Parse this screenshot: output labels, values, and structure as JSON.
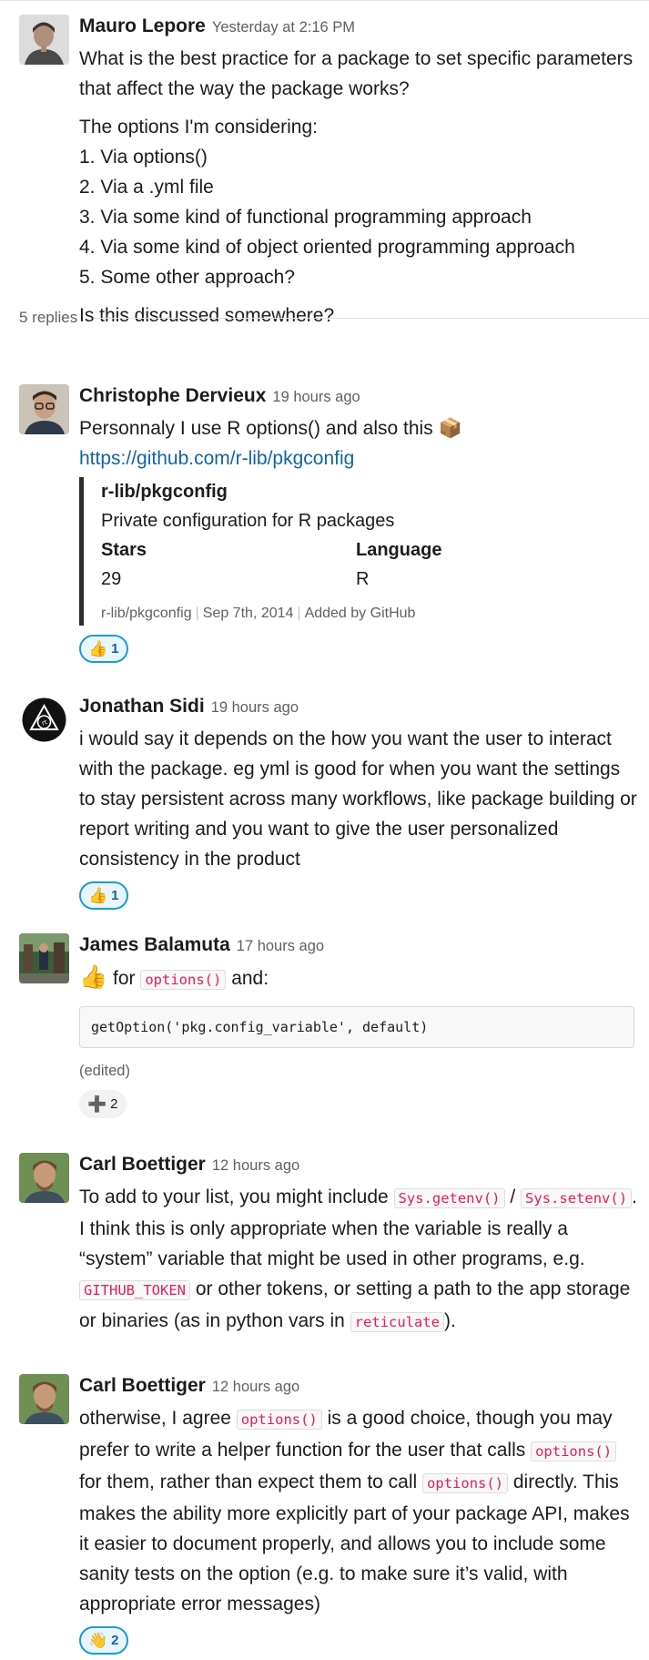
{
  "thread": {
    "replies_label": "5 replies"
  },
  "messages": [
    {
      "author": "Mauro Lepore",
      "time": "Yesterday at 2:16 PM",
      "p1": "What is the best practice for a package to set specific parameters that affect the way the package works?",
      "p2_intro": "The options I'm considering:",
      "options": [
        "1. Via options()",
        "2. Via a .yml file",
        "3. Via some kind of functional programming approach",
        "4. Via some kind of object oriented programming approach",
        "5. Some other approach?"
      ],
      "p3": "Is this discussed somewhere?"
    },
    {
      "author": "Christophe Dervieux",
      "time": "19 hours ago",
      "text": "Personnaly I use R options() and also this",
      "emoji": "📦",
      "link": "https://github.com/r-lib/pkgconfig",
      "attachment": {
        "title": "r-lib/pkgconfig",
        "description": "Private configuration for R packages",
        "fields": [
          {
            "title": "Stars",
            "value": "29"
          },
          {
            "title": "Language",
            "value": "R"
          }
        ],
        "footer": [
          "r-lib/pkgconfig",
          "Sep 7th, 2014",
          "Added by GitHub"
        ]
      },
      "reaction": {
        "emoji": "👍",
        "count": "1"
      }
    },
    {
      "author": "Jonathan Sidi",
      "time": "19 hours ago",
      "text": "i would say it depends on the how you want the user to interact with the package. eg yml is good for when you want the settings to stay persistent across many workflows, like package building or report writing and you want to give the user personalized consistency in the product",
      "reaction": {
        "emoji": "👍",
        "count": "1"
      }
    },
    {
      "author": "James Balamuta",
      "time": "17 hours ago",
      "emoji": "👍",
      "text_a": "for",
      "code": "options()",
      "text_b": "and:",
      "codeblock": "getOption('pkg.config_variable', default)",
      "edited": "(edited)",
      "reaction": {
        "emoji": "➕",
        "count": "2"
      }
    },
    {
      "author": "Carl Boettiger",
      "time": "12 hours ago",
      "t1": "To add to your list, you might include",
      "c1": "Sys.getenv()",
      "t2": "/",
      "c2": "Sys.setenv()",
      "t3": ".  I think this is only appropriate when the variable is really a “system” variable that might be used in other programs, e.g.",
      "c3": "GITHUB_TOKEN",
      "t4": "or other tokens, or setting a path to the app storage or binaries (as in python vars in",
      "c4": "reticulate",
      "t5": ")."
    },
    {
      "author": "Carl Boettiger",
      "time": "12 hours ago",
      "t1": "otherwise, I agree",
      "c1": "options()",
      "t2": "is a good choice, though you may prefer to write a helper function for the user that calls",
      "c2": "options()",
      "t3": "for them, rather than expect them to call",
      "c3": "options()",
      "t4": "directly.  This makes the ability more explicitly part of your package API, makes it easier to document properly, and allows you to include some sanity tests on the option (e.g. to make sure it’s valid, with appropriate error messages)",
      "reaction": {
        "emoji": "👋",
        "count": "2"
      }
    }
  ]
}
